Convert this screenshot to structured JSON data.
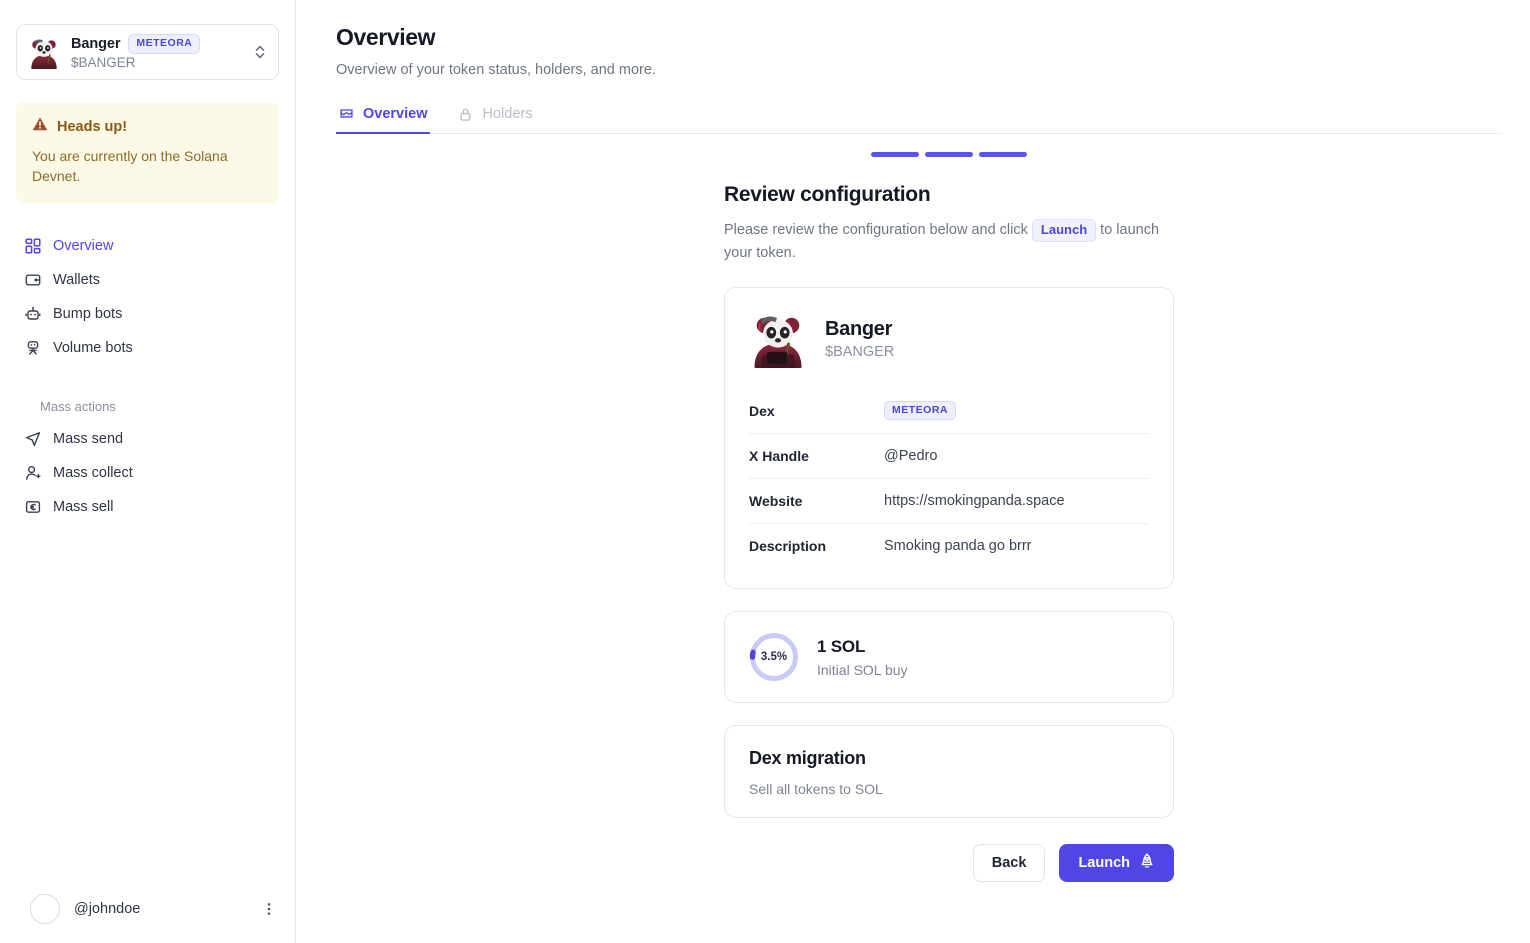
{
  "sidebar": {
    "token_switcher": {
      "name": "Banger",
      "symbol": "$BANGER",
      "badge": "METEORA",
      "avatar_icon": "panda-avatar",
      "chevron_icon": "chevron-up-down-icon"
    },
    "alert": {
      "icon": "warning-triangle-icon",
      "title": "Heads up!",
      "body": "You are currently on the Solana Devnet."
    },
    "nav_items": [
      {
        "label": "Overview",
        "icon": "grid-icon",
        "active": true
      },
      {
        "label": "Wallets",
        "icon": "wallet-icon",
        "active": false
      },
      {
        "label": "Bump bots",
        "icon": "robot-icon",
        "active": false
      },
      {
        "label": "Volume bots",
        "icon": "robot-head-icon",
        "active": false
      }
    ],
    "mass_actions_label": "Mass actions",
    "mass_actions": [
      {
        "label": "Mass send",
        "icon": "send-icon"
      },
      {
        "label": "Mass collect",
        "icon": "user-plus-icon"
      },
      {
        "label": "Mass sell",
        "icon": "currency-box-icon"
      }
    ],
    "user": {
      "name": "@johndoe",
      "avatar_icon": "user-avatar",
      "more_icon": "dots-vertical-icon"
    }
  },
  "main": {
    "title": "Overview",
    "subtitle": "Overview of your token status, holders, and more.",
    "tabs": [
      {
        "label": "Overview",
        "icon": "flag-icon",
        "active": true,
        "disabled": false
      },
      {
        "label": "Holders",
        "icon": "lock-icon",
        "active": false,
        "disabled": true
      }
    ]
  },
  "wizard": {
    "steps_total": 3,
    "steps_completed": 3,
    "step_color": "#5b55ed",
    "title": "Review configuration",
    "desc_before": "Please review the configuration below and click",
    "desc_badge": "Launch",
    "desc_after": "to launch your token.",
    "token_card": {
      "avatar_icon": "panda-avatar",
      "name": "Banger",
      "symbol": "$BANGER",
      "rows": [
        {
          "key": "Dex",
          "value": "METEORA",
          "is_badge": true
        },
        {
          "key": "X Handle",
          "value": "@Pedro",
          "is_badge": false
        },
        {
          "key": "Website",
          "value": "https://smokingpanda.space",
          "is_badge": false
        },
        {
          "key": "Description",
          "value": "Smoking panda go brrr",
          "is_badge": false
        }
      ]
    },
    "sol_card": {
      "percent_label": "3.5%",
      "percent_value": 3.5,
      "amount": "1 SOL",
      "caption": "Initial SOL buy",
      "track_color": "#c7cbf5",
      "arc_color": "#4f46e5"
    },
    "migration_card": {
      "title": "Dex migration",
      "subtitle": "Sell all tokens to SOL"
    },
    "buttons": {
      "back": "Back",
      "launch": "Launch",
      "launch_icon": "rocket-icon"
    }
  }
}
